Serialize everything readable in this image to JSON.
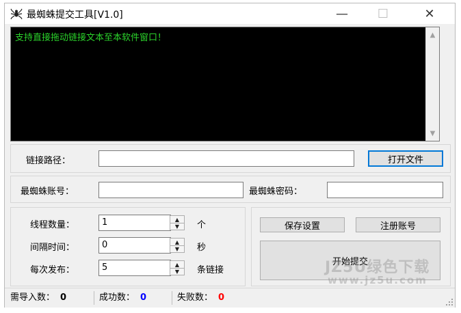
{
  "window": {
    "title": "最蜘蛛提交工具[V1.0]",
    "minimize": "—",
    "maximize": "☐",
    "close": "✕"
  },
  "console": {
    "text": "支持直接拖动链接文本至本软件窗口！"
  },
  "link_path": {
    "label": "链接路径：",
    "value": "",
    "open_button": "打开文件"
  },
  "account": {
    "user_label": "最蜘蛛账号：",
    "user_value": "",
    "password_label": "最蜘蛛密码：",
    "password_value": ""
  },
  "settings": {
    "threads_label": "线程数量：",
    "threads_value": "1",
    "threads_unit": "个",
    "interval_label": "间隔时间：",
    "interval_value": "0",
    "interval_unit": "秒",
    "batch_label": "每次发布：",
    "batch_value": "5",
    "batch_unit": "条链接"
  },
  "actions": {
    "save_settings": "保存设置",
    "register": "注册账号",
    "start_submit": "开始提交"
  },
  "status": {
    "import_label": "需导入数：",
    "import_value": "0",
    "import_color": "#000000",
    "success_label": "成功数：",
    "success_value": "0",
    "success_color": "#0000ff",
    "fail_label": "失败数：",
    "fail_value": "0",
    "fail_color": "#ff0000"
  },
  "watermark": {
    "line1": "JZ5U绿色下载",
    "line2": "www.jz5u.com"
  }
}
